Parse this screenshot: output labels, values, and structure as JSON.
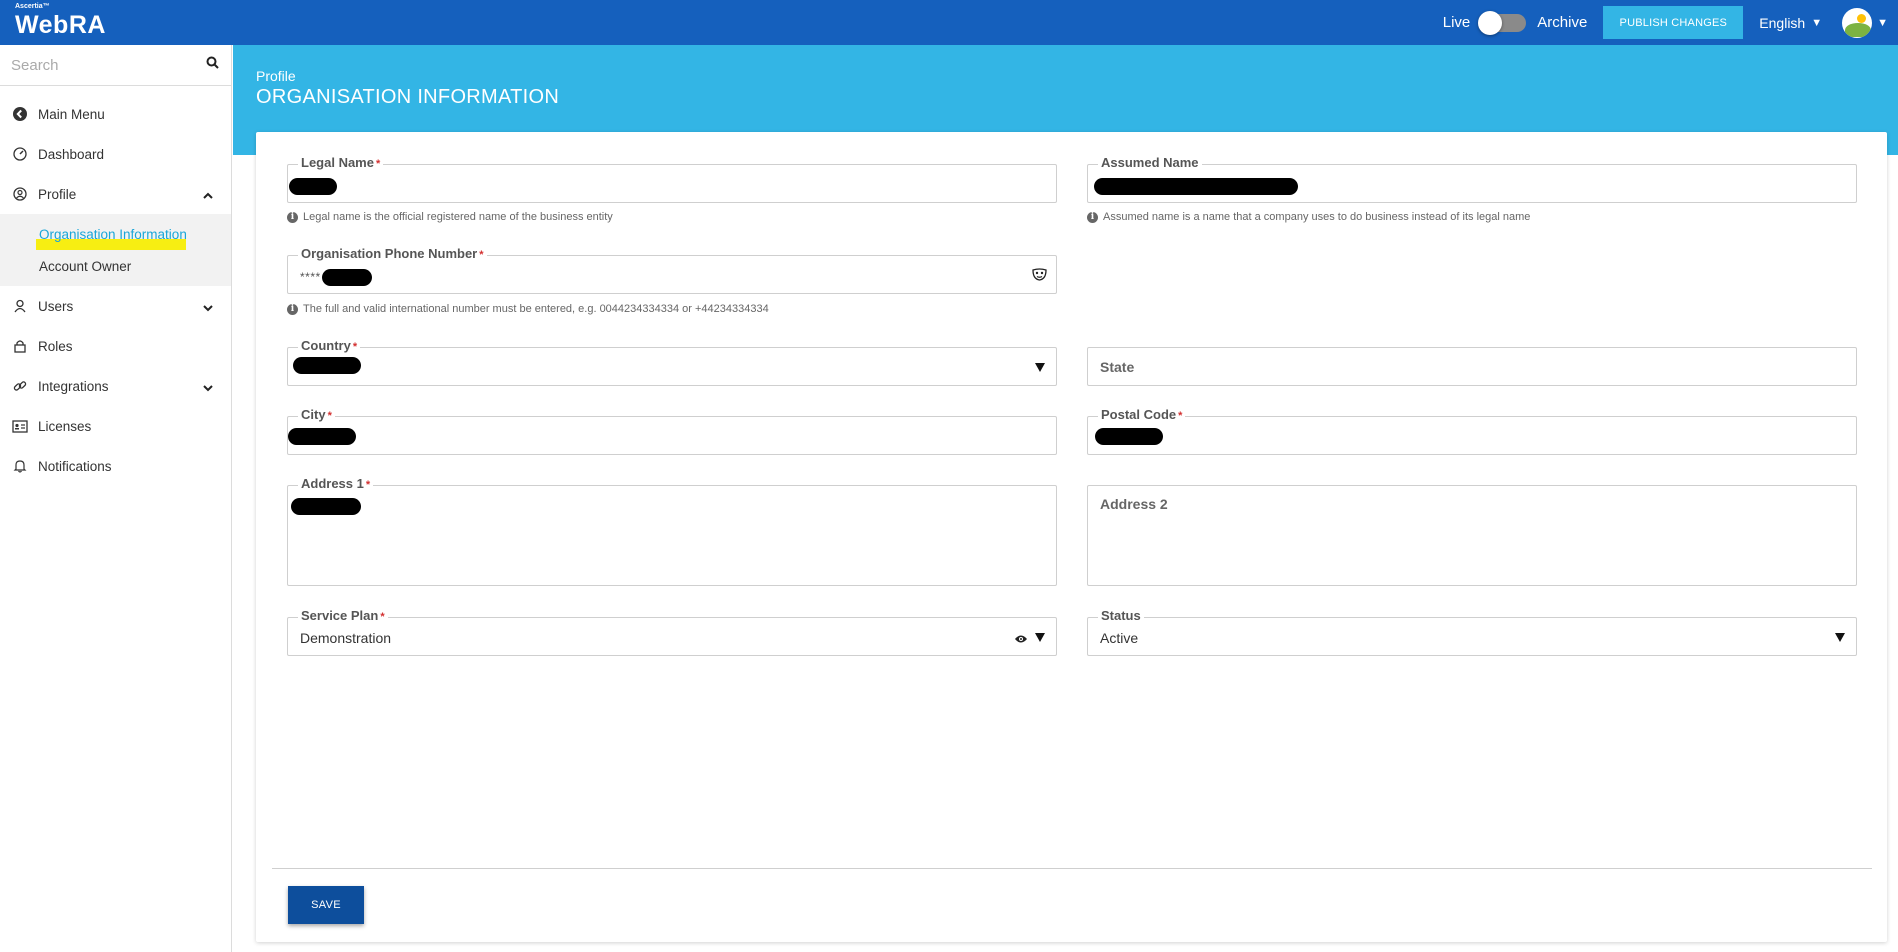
{
  "app": {
    "brand_small": "Ascertia™",
    "brand_name": "WebRA"
  },
  "topbar": {
    "live_label": "Live",
    "archive_label": "Archive",
    "publish_label": "PUBLISH CHANGES",
    "language": "English"
  },
  "sidebar": {
    "search_placeholder": "Search",
    "items": [
      {
        "label": "Main Menu",
        "icon": "back-circle-icon"
      },
      {
        "label": "Dashboard",
        "icon": "speedometer-icon"
      },
      {
        "label": "Profile",
        "icon": "user-circle-icon"
      },
      {
        "label": "Users",
        "icon": "users-icon"
      },
      {
        "label": "Roles",
        "icon": "lock-icon"
      },
      {
        "label": "Integrations",
        "icon": "link-icon"
      },
      {
        "label": "Licenses",
        "icon": "id-card-icon"
      },
      {
        "label": "Notifications",
        "icon": "bell-icon"
      }
    ],
    "profile_sub": [
      {
        "label": "Organisation Information",
        "active": true
      },
      {
        "label": "Account Owner",
        "active": false
      }
    ]
  },
  "page": {
    "breadcrumb": "Profile",
    "title": "ORGANISATION INFORMATION"
  },
  "form": {
    "legal_name": {
      "label": "Legal Name",
      "hint": "Legal name is the official registered name of the business entity"
    },
    "assumed_name": {
      "label": "Assumed Name",
      "hint": "Assumed name is a name that a company uses to do business instead of its legal name"
    },
    "phone": {
      "label": "Organisation Phone Number",
      "masked_prefix": "****",
      "hint": "The full and valid international number must be entered, e.g. 0044234334334 or +44234334334"
    },
    "country": {
      "label": "Country"
    },
    "state": {
      "label": "State"
    },
    "city": {
      "label": "City"
    },
    "postal_code": {
      "label": "Postal Code"
    },
    "address1": {
      "label": "Address 1"
    },
    "address2": {
      "label": "Address 2"
    },
    "service_plan": {
      "label": "Service Plan",
      "value": "Demonstration"
    },
    "status": {
      "label": "Status",
      "value": "Active"
    },
    "required_mark": "*",
    "save_label": "SAVE"
  },
  "colors": {
    "topbar": "#1560bd",
    "header_band": "#33b5e5",
    "publish_button": "#33b5e5",
    "save_button": "#0d4e9c",
    "active_link": "#1aa6d8",
    "highlight": "#f7ee12"
  }
}
